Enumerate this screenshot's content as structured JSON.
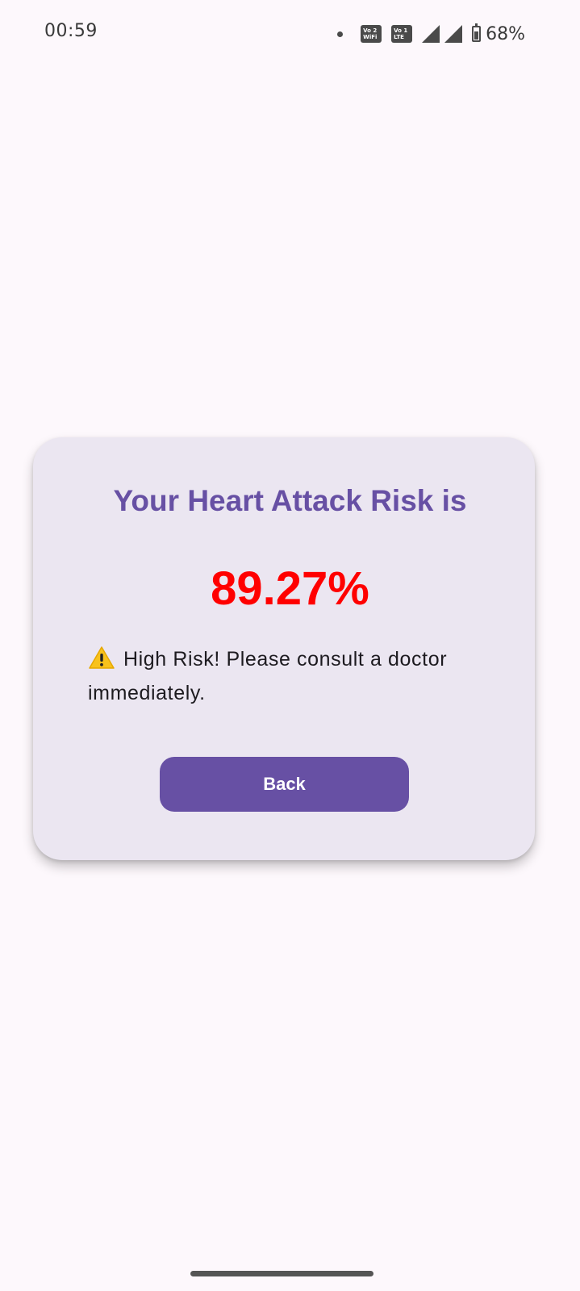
{
  "status_bar": {
    "time": "00:59",
    "volte1_top": "Vo 2",
    "volte1_bottom": "WiFi",
    "volte2_top": "Vo 1",
    "volte2_bottom": "LTE",
    "battery_percent": "68%",
    "battery_level": 0.68
  },
  "result_card": {
    "title": "Your Heart Attack Risk is",
    "risk_value": "89.27%",
    "risk_color": "#FF0000",
    "warning_message": "High Risk! Please consult a doctor immediately.",
    "warning_icon": "warning-icon",
    "back_label": "Back",
    "accent_color": "#6750A4"
  }
}
